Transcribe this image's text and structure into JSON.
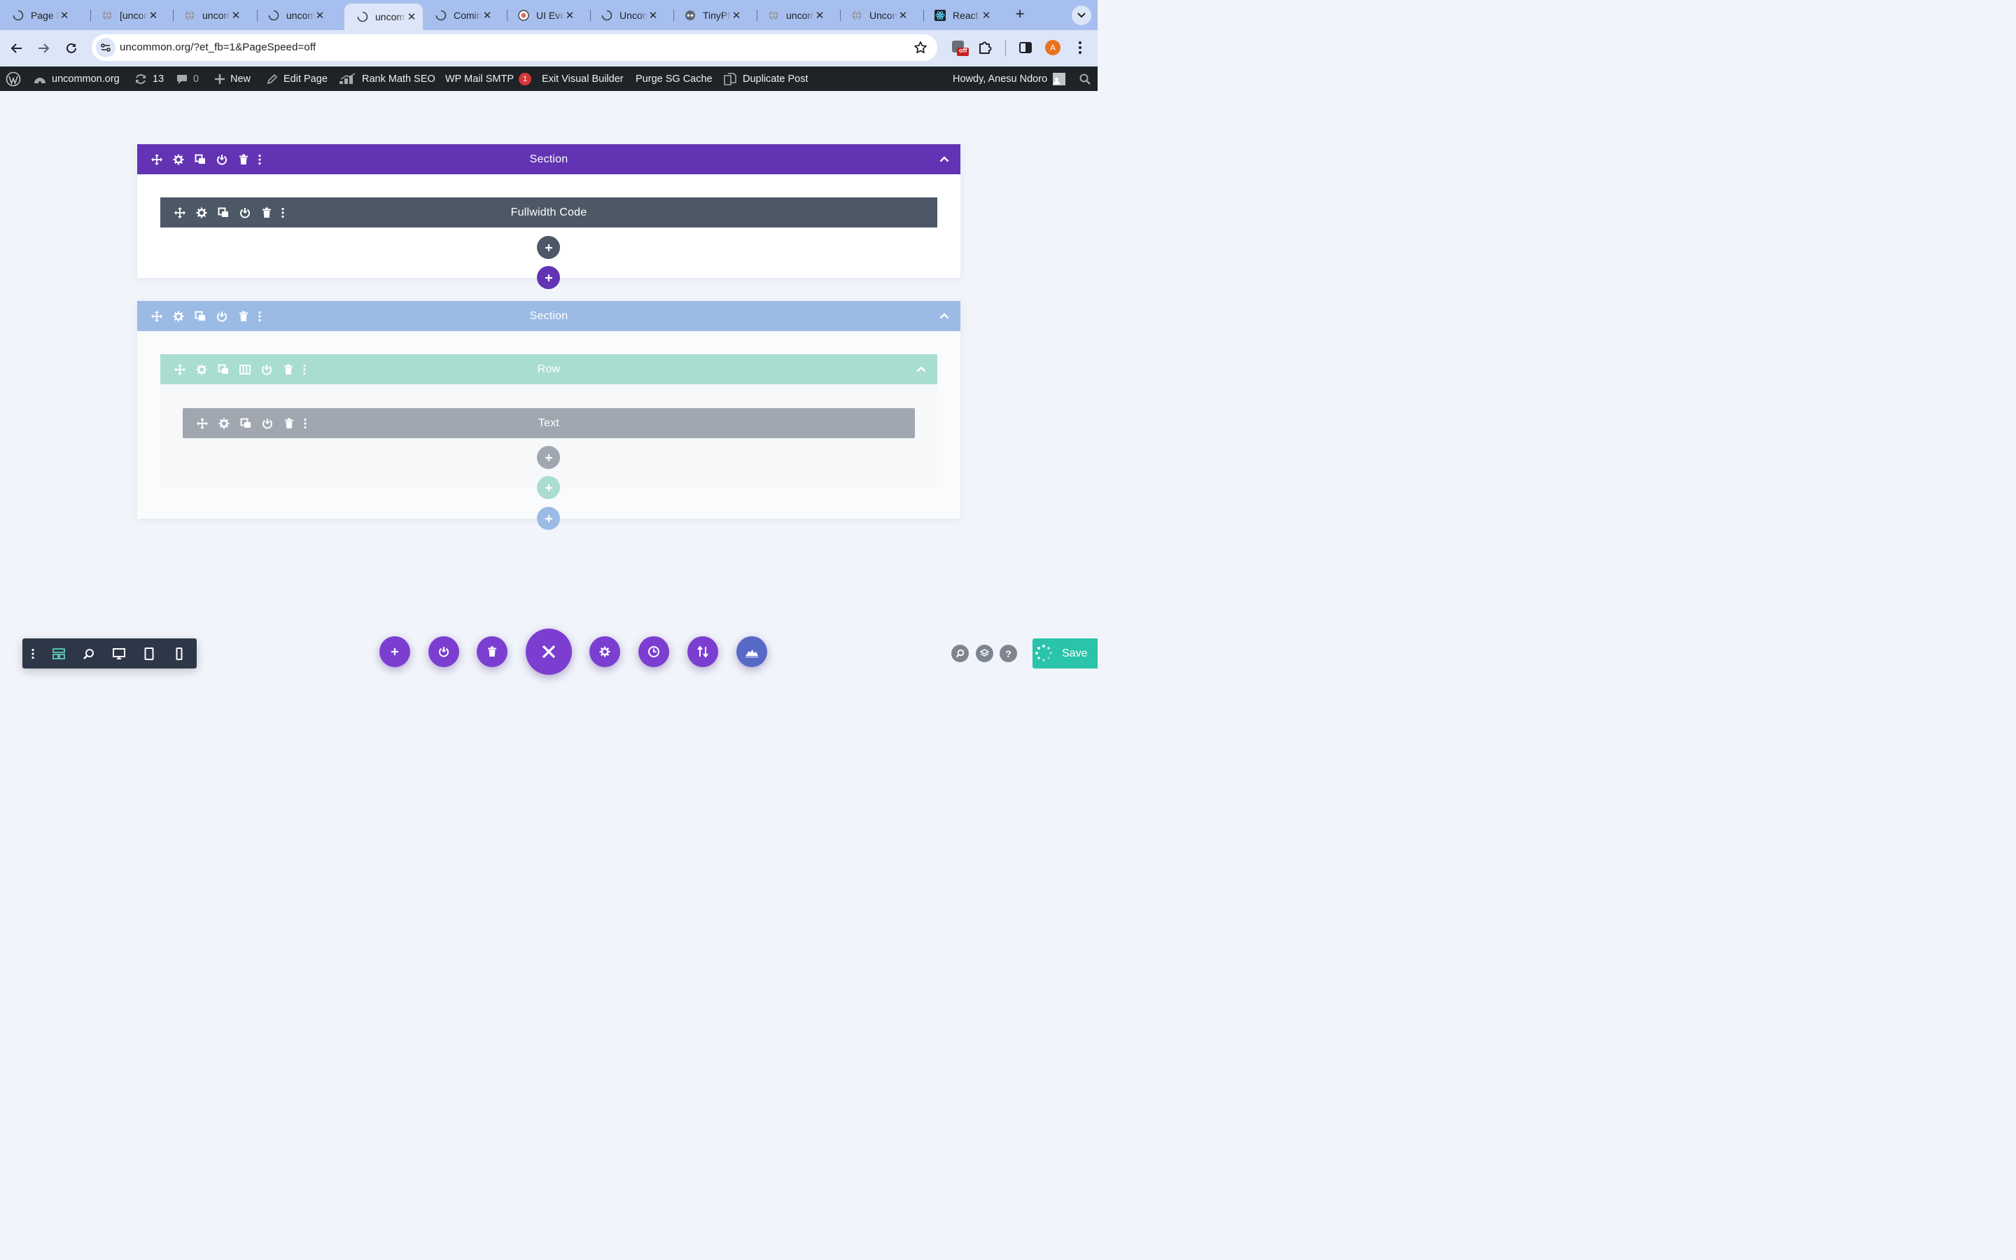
{
  "browser": {
    "tabs": [
      {
        "title": "Page N",
        "icon": "loading-icon",
        "active": false
      },
      {
        "title": "[uncon",
        "icon": "globe-icon",
        "active": false
      },
      {
        "title": "uncom",
        "icon": "globe-icon",
        "active": false
      },
      {
        "title": "uncom",
        "icon": "loading-icon",
        "active": false
      },
      {
        "title": "uncom",
        "icon": "loading-icon",
        "active": true
      },
      {
        "title": "Comin",
        "icon": "loading-icon",
        "active": false
      },
      {
        "title": "UI Eve",
        "icon": "webflow-icon",
        "active": false
      },
      {
        "title": "Uncom",
        "icon": "loading-icon",
        "active": false
      },
      {
        "title": "TinyPN",
        "icon": "panda-icon",
        "active": false
      },
      {
        "title": "uncom",
        "icon": "globe-icon",
        "active": false
      },
      {
        "title": "Uncom",
        "icon": "globe-icon",
        "active": false
      },
      {
        "title": "React",
        "icon": "react-icon",
        "active": false
      }
    ],
    "close_glyph": "✕",
    "url": "uncommon.org/?et_fb=1&PageSpeed=off",
    "extension_badge": "off",
    "profile_initial": "A"
  },
  "adminbar": {
    "site": "uncommon.org",
    "updates": "13",
    "comments": "0",
    "new": "New",
    "edit_page": "Edit Page",
    "rank_math": "Rank Math SEO",
    "wp_mail": "WP Mail SMTP",
    "wp_mail_badge": "1",
    "exit_builder": "Exit Visual Builder",
    "purge": "Purge SG Cache",
    "duplicate": "Duplicate Post",
    "howdy": "Howdy, Anesu Ndoro"
  },
  "builder": {
    "section1": {
      "title": "Section",
      "module": "Fullwidth Code"
    },
    "section2": {
      "title": "Section",
      "row": "Row",
      "module": "Text"
    }
  },
  "footer": {
    "save_label": "Save"
  },
  "colors": {
    "section_purple": "#6234b3",
    "section_blue": "#9bbbe5",
    "row_green": "#a9ddd1",
    "module_dark": "#4c5866",
    "module_grey": "#a0a7b0",
    "save_green": "#29c4a9"
  }
}
